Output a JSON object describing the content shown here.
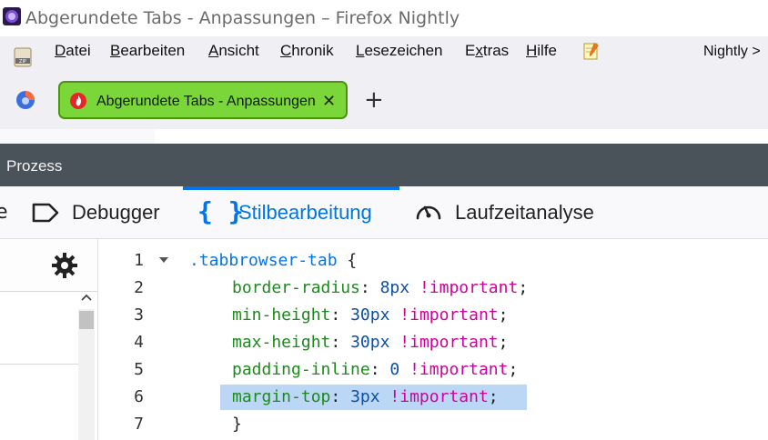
{
  "window": {
    "title": "Abgerundete Tabs - Anpassungen – Firefox Nightly"
  },
  "menubar": {
    "items": [
      {
        "accel": "D",
        "rest": "atei"
      },
      {
        "accel": "B",
        "rest": "earbeiten"
      },
      {
        "accel": "A",
        "rest": "nsicht"
      },
      {
        "accel": "C",
        "rest": "hronik"
      },
      {
        "accel": "L",
        "rest": "esezeichen"
      },
      {
        "pre": "E",
        "accel": "x",
        "rest": "tras"
      },
      {
        "accel": "H",
        "rest": "ilfe"
      }
    ],
    "right_label": "Nightly >"
  },
  "tabs": {
    "active_title": "Abgerundete Tabs - Anpassungen",
    "close_glyph": "✕",
    "new_tab_glyph": "+",
    "active_color": "#7bd63a"
  },
  "devtools": {
    "title": "Prozess",
    "tools": [
      {
        "label": "Debugger",
        "icon": "debugger-icon"
      },
      {
        "label": "Stilbearbeitung",
        "icon": "braces-icon",
        "active": true
      },
      {
        "label": "Laufzeitanalyse",
        "icon": "performance-icon"
      }
    ],
    "partial_left_glyph": "e",
    "braces_glyph": "{ }",
    "accent_color": "#0074e8"
  },
  "editor": {
    "line_numbers": [
      "1",
      "2",
      "3",
      "4",
      "5",
      "6",
      "7"
    ],
    "lines": [
      {
        "selector": ".tabbrowser-tab",
        "brace": " {"
      },
      {
        "prop": "border-radius",
        "colon": ": ",
        "value": "8px",
        "important": "!important",
        "semi": ";"
      },
      {
        "prop": "min-height",
        "colon": ": ",
        "value": "30px",
        "important": "!important",
        "semi": ";"
      },
      {
        "prop": "max-height",
        "colon": ": ",
        "value": "30px",
        "important": "!important",
        "semi": ";"
      },
      {
        "prop": "padding-inline",
        "colon": ": ",
        "value": "0",
        "important": "!important",
        "semi": ";"
      },
      {
        "prop": "margin-top",
        "colon": ": ",
        "value": "3px",
        "important": "!important",
        "semi": ";"
      },
      {
        "brace": "}"
      }
    ],
    "highlighted_line": "6"
  }
}
